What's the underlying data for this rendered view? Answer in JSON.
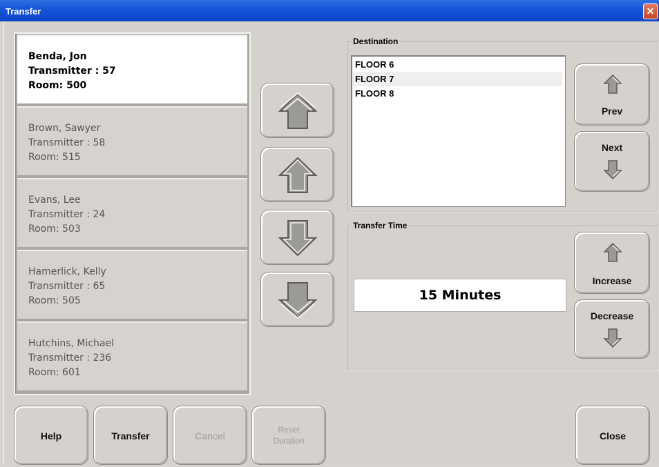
{
  "window": {
    "title": "Transfer",
    "close_glyph": "✕"
  },
  "patients": [
    {
      "name": "Benda, Jon",
      "transmitter": "Transmitter : 57",
      "room": "Room: 500",
      "selected": true
    },
    {
      "name": "Brown, Sawyer",
      "transmitter": "Transmitter : 58",
      "room": "Room: 515"
    },
    {
      "name": "Evans, Lee",
      "transmitter": "Transmitter : 24",
      "room": "Room: 503"
    },
    {
      "name": "Hamerlick, Kelly",
      "transmitter": "Transmitter : 65",
      "room": "Room: 505"
    },
    {
      "name": "Hutchins, Michael",
      "transmitter": "Transmitter : 236",
      "room": "Room: 601"
    }
  ],
  "list_nav": {
    "first_icon": "double-up-arrow-icon",
    "up_icon": "up-arrow-icon",
    "down_icon": "down-arrow-icon",
    "last_icon": "double-down-arrow-icon"
  },
  "destination": {
    "title": "Destination",
    "items": [
      "FLOOR 6",
      "FLOOR 7",
      "FLOOR 8"
    ],
    "selected_index": 1,
    "prev_label": "Prev",
    "next_label": "Next"
  },
  "transfer_time": {
    "title": "Transfer Time",
    "value": "15 Minutes",
    "increase_label": "Increase",
    "decrease_label": "Decrease"
  },
  "footer": {
    "help": "Help",
    "transfer": "Transfer",
    "cancel": "Cancel",
    "reset_line1": "Reset",
    "reset_line2": "Duration",
    "close": "Close"
  },
  "colors": {
    "titlebar": "#0b45c9",
    "arrow_fill": "#9c9a96",
    "arrow_stroke": "#5f5d59"
  }
}
